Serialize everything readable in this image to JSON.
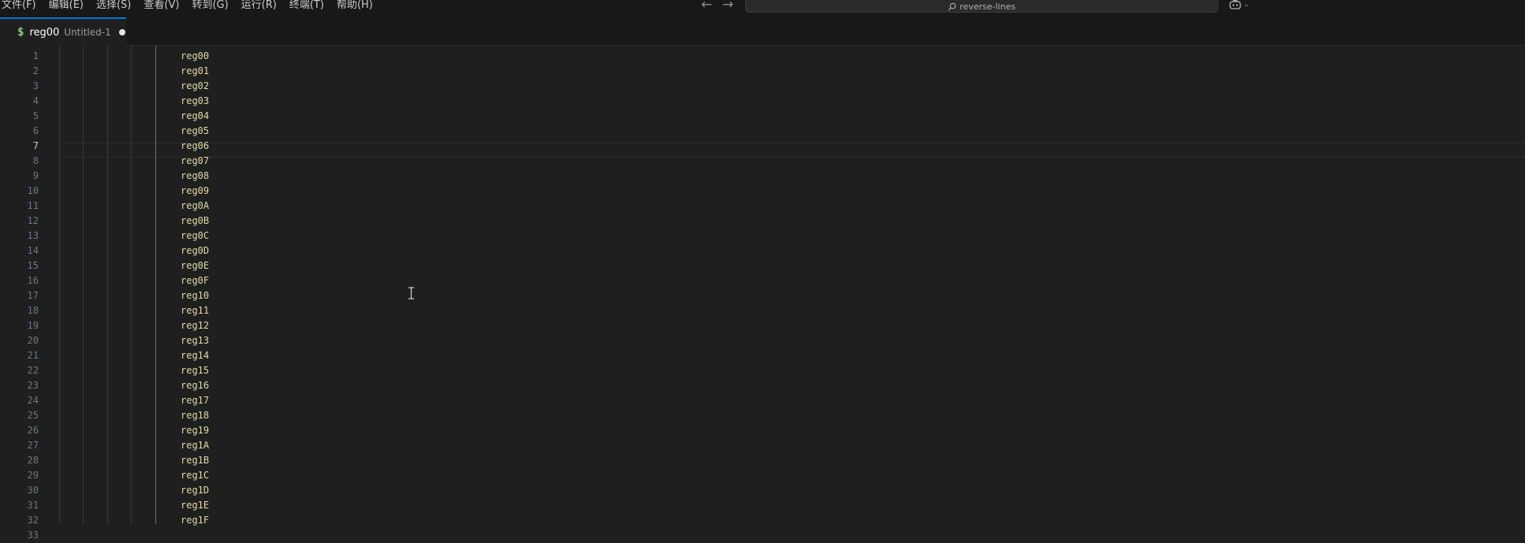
{
  "menu": {
    "items": [
      "文件(F)",
      "编辑(E)",
      "选择(S)",
      "查看(V)",
      "转到(G)",
      "运行(R)",
      "终端(T)",
      "帮助(H)"
    ]
  },
  "command_center": {
    "text": "reverse-lines"
  },
  "tab": {
    "icon": "$",
    "title": "reg00",
    "description": "Untitled-1"
  },
  "editor": {
    "active_line": 7,
    "line_numbers": [
      "1",
      "2",
      "3",
      "4",
      "5",
      "6",
      "7",
      "8",
      "9",
      "10",
      "11",
      "12",
      "13",
      "14",
      "15",
      "16",
      "17",
      "18",
      "19",
      "20",
      "21",
      "22",
      "23",
      "24",
      "25",
      "26",
      "27",
      "28",
      "29",
      "30",
      "31",
      "32",
      "33"
    ],
    "lines": [
      "reg00",
      "reg01",
      "reg02",
      "reg03",
      "reg04",
      "reg05",
      "reg06",
      "reg07",
      "reg08",
      "reg09",
      "reg0A",
      "reg0B",
      "reg0C",
      "reg0D",
      "reg0E",
      "reg0F",
      "reg10",
      "reg11",
      "reg12",
      "reg13",
      "reg14",
      "reg15",
      "reg16",
      "reg17",
      "reg18",
      "reg19",
      "reg1A",
      "reg1B",
      "reg1C",
      "reg1D",
      "reg1E",
      "reg1F",
      ""
    ]
  },
  "colors": {
    "accent": "#0078d4",
    "code_text": "#dcdcaa",
    "line_number": "#6e7681",
    "shell_icon": "#89d185"
  }
}
